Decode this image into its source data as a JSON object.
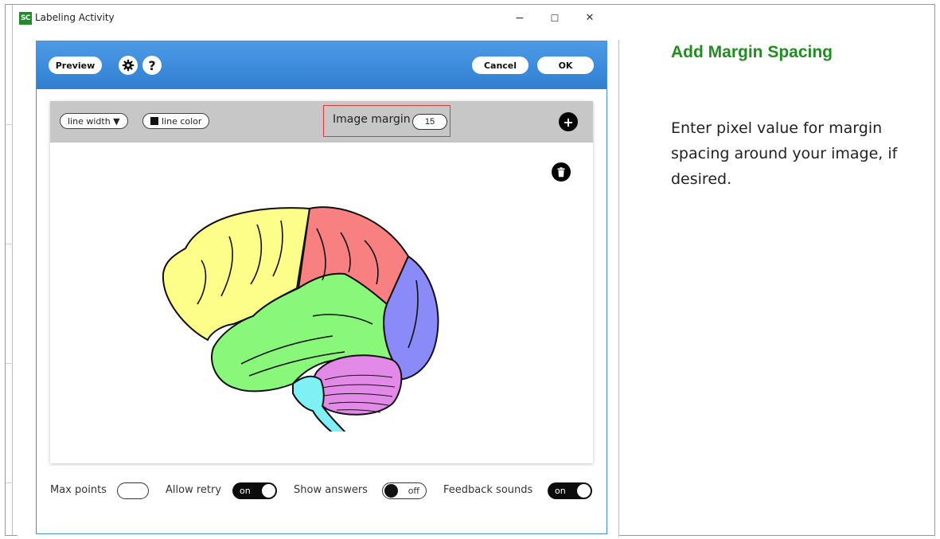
{
  "window": {
    "icon_text": "SC",
    "title": "Labeling Activity",
    "minimize_glyph": "−",
    "maximize_glyph": "☐",
    "close_glyph": "✕"
  },
  "toolbar": {
    "preview_label": "Preview",
    "settings_icon": "gear-icon",
    "help_glyph": "?",
    "cancel_label": "Cancel",
    "ok_label": "OK"
  },
  "editor": {
    "line_width_label": "line width ▼",
    "line_color_label": "line color",
    "image_margin_label": "Image margin",
    "image_margin_value": "15",
    "add_glyph": "+",
    "delete_icon": "trash-icon"
  },
  "brain_colors": {
    "frontal": "#fdfd8a",
    "parietal": "#f98080",
    "occipital": "#8a8af9",
    "temporal": "#88f77a",
    "cerebellum": "#e38ae8",
    "brainstem": "#7ff0f3"
  },
  "settings": {
    "max_points_label": "Max points",
    "allow_retry_label": "Allow retry",
    "allow_retry_state": "on",
    "show_answers_label": "Show answers",
    "show_answers_state": "off",
    "feedback_sounds_label": "Feedback sounds",
    "feedback_sounds_state": "on"
  },
  "help_panel": {
    "title": "Add Margin Spacing",
    "body": "Enter pixel value for margin spacing around your image, if desired."
  },
  "colors": {
    "accent_blue": "#3a8ad9",
    "help_title_green": "#1e8f1e",
    "highlight_red": "#e03a3a"
  }
}
